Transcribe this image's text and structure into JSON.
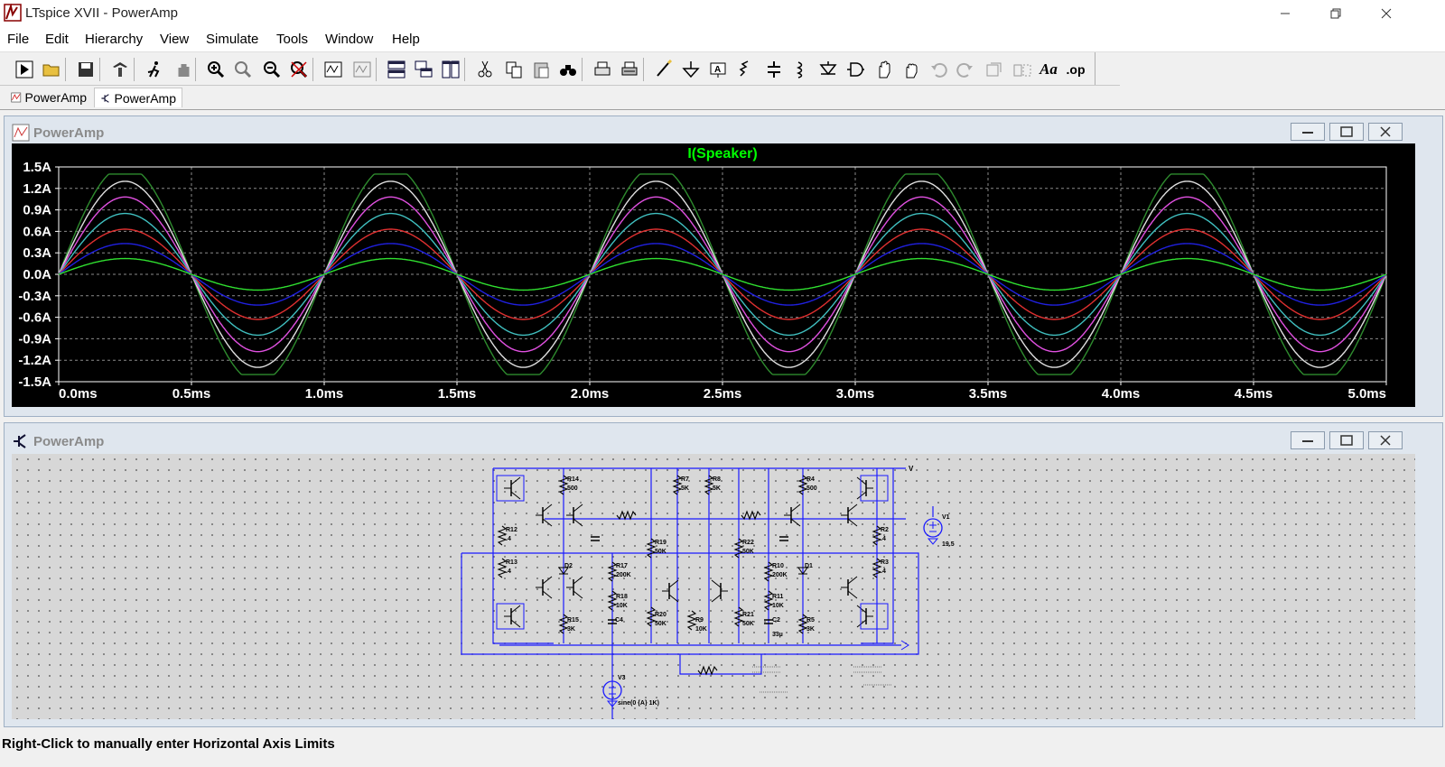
{
  "app": {
    "title": "LTspice XVII - PowerAmp"
  },
  "menu": [
    "File",
    "Edit",
    "Hierarchy",
    "View",
    "Simulate",
    "Tools",
    "Window",
    "Help"
  ],
  "toolbar": {
    "icons": [
      "run-icon",
      "open-icon",
      "save-icon",
      "control-panel-icon",
      "halt-icon",
      "pan-icon",
      "zoom-in-icon",
      "zoom-area-icon",
      "zoom-out-icon",
      "zoom-cancel-icon",
      "autorange-icon",
      "waveform-icon",
      "tile-horizontal-icon",
      "cascade-icon",
      "tile-vertical-icon",
      "cut-icon",
      "copy-icon",
      "paste-icon",
      "find-icon",
      "print-icon",
      "print-setup-icon",
      "wire-icon",
      "ground-icon",
      "label-icon",
      "resistor-icon",
      "capacitor-icon",
      "inductor-icon",
      "diode-icon",
      "component-icon",
      "move-icon",
      "drag-icon",
      "undo-icon",
      "redo-icon",
      "rotate-icon",
      "mirror-icon",
      "text-icon",
      "spice-directive-icon"
    ],
    "text_aa": "Aa",
    "text_op": ".op"
  },
  "tabs": [
    {
      "label": "PowerAmp",
      "icon": "waveform-tab-icon",
      "active": false
    },
    {
      "label": "PowerAmp",
      "icon": "schematic-tab-icon",
      "active": true
    }
  ],
  "plot_window": {
    "title": "PowerAmp"
  },
  "schematic_window": {
    "title": "PowerAmp"
  },
  "colors": {
    "plot_bg": "#000000",
    "trace_label": "#00ff00",
    "schematic_bg": "#d7d7d7",
    "wire": "#0000ff"
  },
  "chart_data": {
    "type": "line",
    "title": "I(Speaker)",
    "xlabel": "",
    "ylabel": "",
    "xlim": [
      0,
      5.0
    ],
    "ylim": [
      -1.5,
      1.5
    ],
    "x_ticks": [
      "0.0ms",
      "0.5ms",
      "1.0ms",
      "1.5ms",
      "2.0ms",
      "2.5ms",
      "3.0ms",
      "3.5ms",
      "4.0ms",
      "4.5ms",
      "5.0ms"
    ],
    "y_ticks": [
      "1.5A",
      "1.2A",
      "0.9A",
      "0.6A",
      "0.3A",
      "0.0A",
      "-0.3A",
      "-0.6A",
      "-0.9A",
      "-1.2A",
      "-1.5A"
    ],
    "grid": true,
    "frequency_khz": 1,
    "series": [
      {
        "amplitude": 1.4,
        "clip": 1.4,
        "color": "#2e8b2e"
      },
      {
        "amplitude": 1.3,
        "color": "#e0e0e0"
      },
      {
        "amplitude": 1.08,
        "color": "#e050e0"
      },
      {
        "amplitude": 0.85,
        "color": "#40c0c0"
      },
      {
        "amplitude": 0.63,
        "color": "#e03030"
      },
      {
        "amplitude": 0.43,
        "color": "#2020e0"
      },
      {
        "amplitude": 0.22,
        "color": "#30e030"
      }
    ]
  },
  "schematic": {
    "labels": [
      "R14",
      "500",
      "R7",
      "5K",
      "R8",
      "5K",
      "R4",
      "500",
      "R12",
      ".4",
      "R2",
      ".4",
      "R13",
      ".4",
      "R3",
      ".4",
      "R19",
      "50K",
      "R22",
      "50K",
      "R17",
      "200K",
      "R10",
      "200K",
      "D2",
      "D1",
      "R18",
      "10K",
      "R11",
      "10K",
      "C4",
      "C2",
      "33µ",
      "R15",
      "3K",
      "R5",
      "3K",
      "R20",
      "50K",
      "R9",
      "10K",
      "R21",
      "50K",
      "V1",
      "19.5",
      "V3",
      "sine(0 {A} 1K)",
      "V"
    ]
  },
  "status": {
    "text": "Right-Click to manually enter Horizontal Axis Limits"
  }
}
